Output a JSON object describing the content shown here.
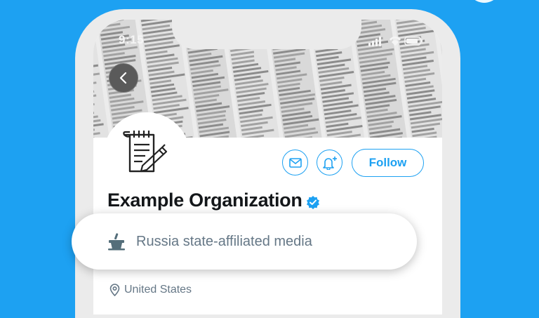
{
  "status_bar": {
    "time": "9:15"
  },
  "profile": {
    "name": "Example Organization",
    "verified": true,
    "follow_label": "Follow",
    "state_label": "Russia state-affiliated media",
    "location": "United States"
  },
  "colors": {
    "background": "#1da1f2",
    "accent": "#1da1f2",
    "name_text": "#14171a",
    "secondary_text": "#657786"
  },
  "icons": [
    "chevron-left-icon",
    "notepad-pen-icon",
    "mail-icon",
    "bell-plus-icon",
    "verified-badge-icon",
    "podium-icon",
    "location-pin-icon"
  ]
}
